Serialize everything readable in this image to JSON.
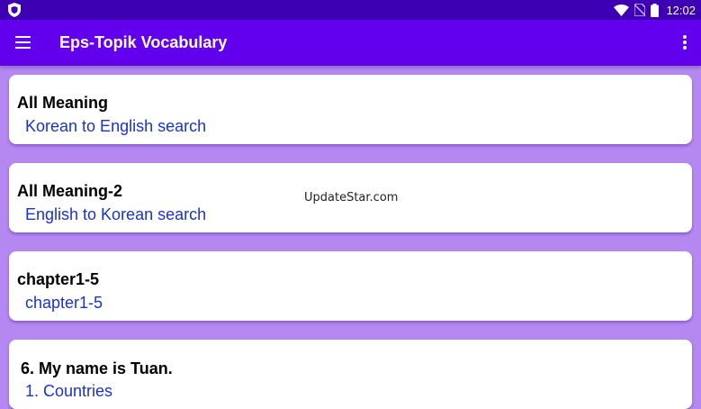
{
  "status_bar": {
    "time": "12:02",
    "icons": [
      "shield-icon",
      "wifi-icon",
      "no-sim-icon",
      "battery-icon"
    ]
  },
  "app_bar": {
    "title": "Eps-Topik Vocabulary",
    "icons": [
      "menu-icon",
      "overflow-menu-icon"
    ]
  },
  "cards": [
    {
      "title": "All Meaning",
      "subtitle": "Korean to English search"
    },
    {
      "title": "All Meaning-2",
      "subtitle": "English to Korean search"
    },
    {
      "title": "chapter1-5",
      "subtitle": "chapter1-5"
    },
    {
      "title": "6. My name is Tuan.",
      "subtitle": "1. Countries"
    }
  ],
  "watermark": "UpdateStar.com",
  "colors": {
    "status_bar": "#3d00b3",
    "app_bar": "#6200ee",
    "background": "#b488f0",
    "subtitle_text": "#1a33cc"
  }
}
